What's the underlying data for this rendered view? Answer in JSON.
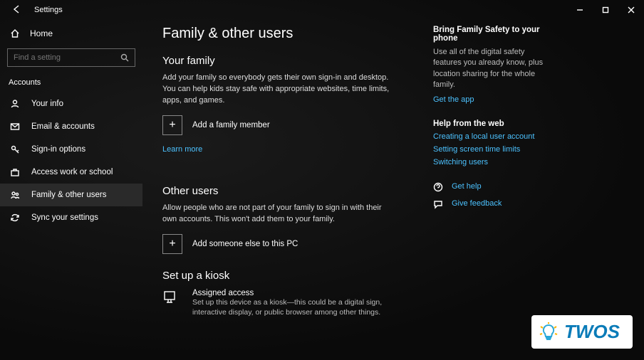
{
  "window": {
    "title": "Settings"
  },
  "sidebar": {
    "home_label": "Home",
    "search_placeholder": "Find a setting",
    "section_label": "Accounts",
    "items": [
      {
        "label": "Your info"
      },
      {
        "label": "Email & accounts"
      },
      {
        "label": "Sign-in options"
      },
      {
        "label": "Access work or school"
      },
      {
        "label": "Family & other users"
      },
      {
        "label": "Sync your settings"
      }
    ]
  },
  "main": {
    "title": "Family & other users",
    "family": {
      "heading": "Your family",
      "desc": "Add your family so everybody gets their own sign-in and desktop. You can help kids stay safe with appropriate websites, time limits, apps, and games.",
      "add_label": "Add a family member",
      "learn_more": "Learn more"
    },
    "other": {
      "heading": "Other users",
      "desc": "Allow people who are not part of your family to sign in with their own accounts. This won't add them to your family.",
      "add_label": "Add someone else to this PC"
    },
    "kiosk": {
      "heading": "Set up a kiosk",
      "item_title": "Assigned access",
      "item_desc": "Set up this device as a kiosk—this could be a digital sign, interactive display, or public browser among other things."
    }
  },
  "rail": {
    "safety": {
      "heading": "Bring Family Safety to your phone",
      "desc": "Use all of the digital safety features you already know, plus location sharing for the whole family.",
      "link": "Get the app"
    },
    "help": {
      "heading": "Help from the web",
      "links": [
        "Creating a local user account",
        "Setting screen time limits",
        "Switching users"
      ]
    },
    "footer": {
      "get_help": "Get help",
      "feedback": "Give feedback"
    }
  },
  "watermark": "TWOS"
}
